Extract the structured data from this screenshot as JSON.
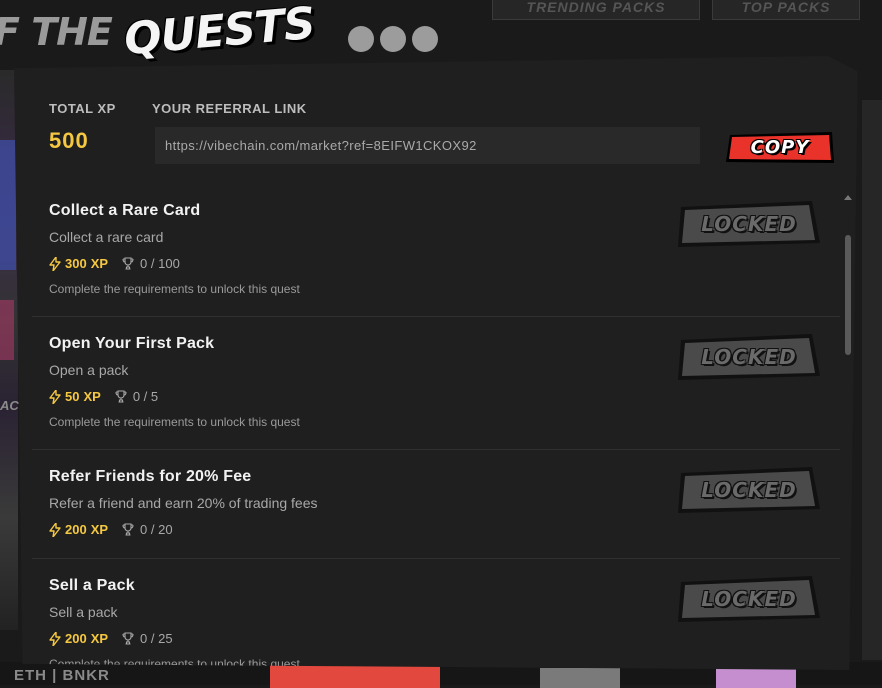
{
  "background": {
    "title_prefix": "F THE",
    "title_main": "QUESTS",
    "tabs": [
      "TRENDING PACKS",
      "TOP PACKS"
    ],
    "left_letters": "AC",
    "bottom_text": "ETH | BNKR"
  },
  "modal": {
    "total_xp_label": "TOTAL XP",
    "total_xp_value": "500",
    "referral_label": "YOUR REFERRAL LINK",
    "referral_link": "https://vibechain.com/market?ref=8EIFW1CKOX92",
    "copy_label": "COPY"
  },
  "quests": [
    {
      "title": "Collect a Rare Card",
      "description": "Collect a rare card",
      "xp": "300",
      "xp_unit": "XP",
      "progress": "0 / 100",
      "note": "Complete the requirements to unlock this quest",
      "status": "LOCKED"
    },
    {
      "title": "Open Your First Pack",
      "description": "Open a pack",
      "xp": "50",
      "xp_unit": "XP",
      "progress": "0 / 5",
      "note": "Complete the requirements to unlock this quest",
      "status": "LOCKED"
    },
    {
      "title": "Refer Friends for 20% Fee",
      "description": "Refer a friend and earn 20% of trading fees",
      "xp": "200",
      "xp_unit": "XP",
      "progress": "0 / 20",
      "note": "",
      "status": "LOCKED"
    },
    {
      "title": "Sell a Pack",
      "description": "Sell a pack",
      "xp": "200",
      "xp_unit": "XP",
      "progress": "0 / 25",
      "note": "Complete the requirements to unlock this quest",
      "status": "LOCKED"
    }
  ],
  "colors": {
    "accent_gold": "#f5c842",
    "copy_red": "#e8322a",
    "locked_gray": "#4a4a4a"
  },
  "icons": {
    "xp": "lightning-bolt-icon",
    "progress": "trophy-icon"
  }
}
